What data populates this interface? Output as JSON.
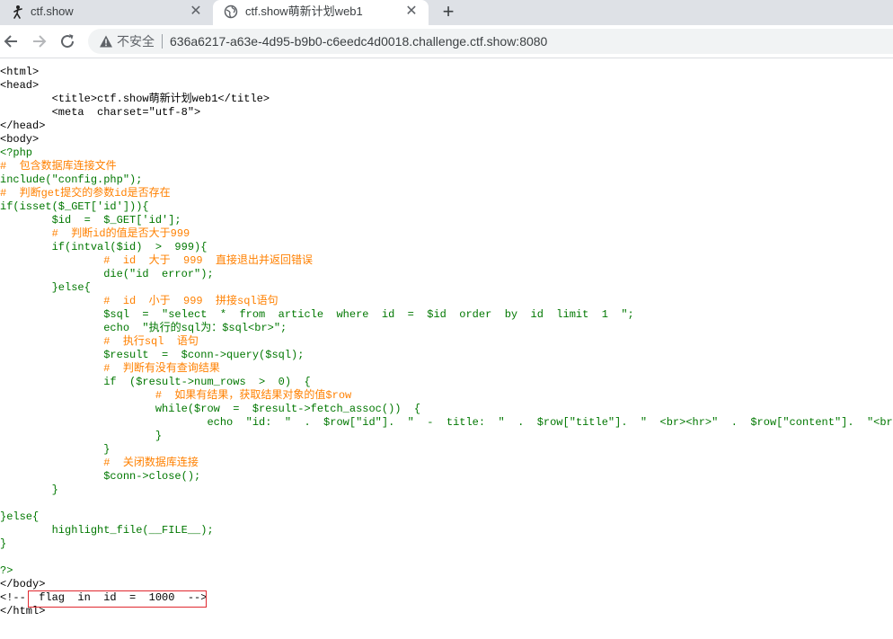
{
  "tabs": [
    {
      "title": "ctf.show"
    },
    {
      "title": "ctf.show萌新计划web1"
    }
  ],
  "toolbar": {
    "security": "不安全",
    "url": "636a6217-a63e-4d95-b9b0-c6eedc4d0018.challenge.ctf.show:8080"
  },
  "code": [
    "<html>",
    "<head>",
    "        <title>ctf.show萌新计划web1</title>",
    "        <meta  charset=\"utf-8\">",
    "</head>",
    "<body>",
    "<?php",
    "#  包含数据库连接文件",
    "include(\"config.php\");",
    "#  判断get提交的参数id是否存在",
    "if(isset($_GET['id'])){",
    "        $id  =  $_GET['id'];",
    "        #  判断id的值是否大于999",
    "        if(intval($id)  >  999){",
    "                #  id  大于  999  直接退出并返回错误",
    "                die(\"id  error\");",
    "        }else{",
    "                #  id  小于  999  拼接sql语句",
    "                $sql  =  \"select  *  from  article  where  id  =  $id  order  by  id  limit  1  \";",
    "                echo  \"执行的sql为：$sql<br>\";",
    "                #  执行sql  语句",
    "                $result  =  $conn->query($sql);",
    "                #  判断有没有查询结果",
    "                if  ($result->num_rows  >  0)  {",
    "                        #  如果有结果，获取结果对象的值$row",
    "                        while($row  =  $result->fetch_assoc())  {",
    "                                echo  \"id:  \"  .  $row[\"id\"].  \"  -  title:  \"  .  $row[\"title\"].  \"  <br><hr>\"  .  $row[\"content\"].  \"<br>\";",
    "                        }",
    "                }",
    "                #  关闭数据库连接",
    "                $conn->close();",
    "        }",
    "",
    "}else{",
    "        highlight_file(__FILE__);",
    "}",
    "",
    "?>",
    "</body>",
    "<!--  flag  in  id  =  1000  -->",
    "</html>"
  ]
}
